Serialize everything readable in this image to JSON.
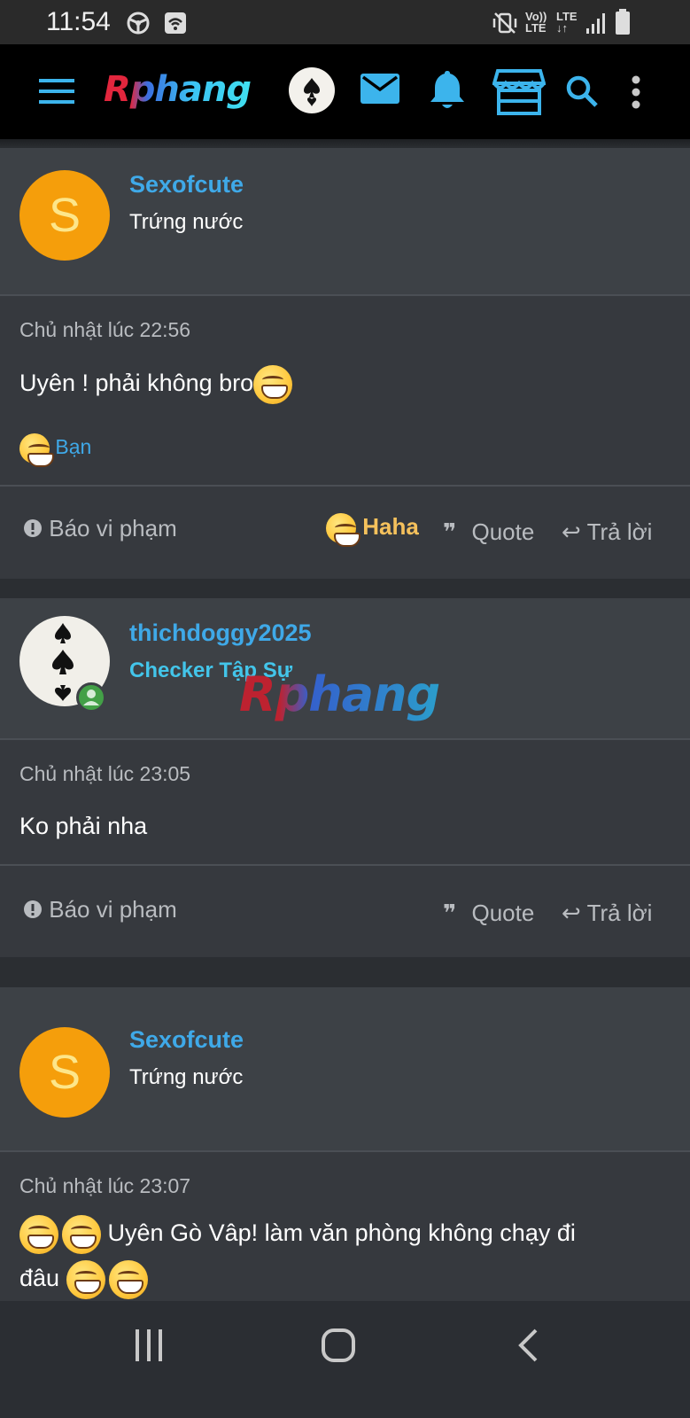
{
  "status_bar": {
    "time": "11:54",
    "volte_label": "Vo))",
    "lte_label": "LTE",
    "lte_label_2": "LTE",
    "icons": [
      "steering-wheel-icon",
      "wifi-box-icon",
      "mute-vibrate-icon",
      "signal-icon",
      "battery-icon"
    ]
  },
  "nav": {
    "logo": "Rphang",
    "icons": [
      "menu-icon",
      "avatar-icon",
      "mail-icon",
      "bell-icon",
      "store-icon",
      "search-icon",
      "more-vert-icon"
    ],
    "accent_color": "#3cb4ec"
  },
  "posts": [
    {
      "username": "Sexofcute",
      "user_title": "Trứng nước",
      "avatar_letter": "S",
      "avatar_color": "#f59e0b",
      "timestamp": "Chủ nhật lúc 22:56",
      "content": "Uyên ! phải không bro",
      "reaction_text": "Bạn",
      "actions": {
        "report": "Báo vi phạm",
        "haha": "Haha",
        "quote": "Quote",
        "reply": "Trả lời"
      }
    },
    {
      "username": "thichdoggy2025",
      "user_title": "Checker Tập Sự",
      "timestamp": "Chủ nhật lúc 23:05",
      "content": "Ko phải nha",
      "actions": {
        "report": "Báo vi phạm",
        "quote": "Quote",
        "reply": "Trả lời"
      }
    },
    {
      "username": "Sexofcute",
      "user_title": "Trứng nước",
      "avatar_letter": "S",
      "avatar_color": "#f59e0b",
      "timestamp": "Chủ nhật lúc 23:07",
      "content_line1": "Uyên Gò Vâp! làm văn phòng không chạy đi",
      "content_line2": "đâu"
    }
  ],
  "watermark": "Rphang",
  "system_nav": {
    "icons": [
      "recents-icon",
      "home-icon",
      "back-icon"
    ]
  }
}
